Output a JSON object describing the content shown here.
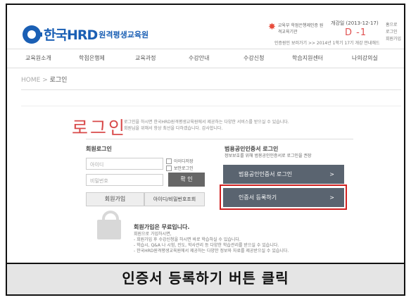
{
  "header": {
    "logo_main": "한국HRD",
    "logo_sub": "원격평생교육원",
    "moe_text": "교육부 학점은행제인증 원격교육기관",
    "dday_top": "개강일 (2013-12-17)",
    "dday": "D -1",
    "login_links": [
      "홈으로",
      "로그인",
      "회원가입"
    ],
    "topinfo": "인증원인 보러가기 >>    2014년 1학기 17기 개강 안내해드"
  },
  "nav": [
    "교육원소개",
    "학점은행제",
    "교육과정",
    "수강안내",
    "수강신청",
    "학습지원센터",
    "나의강의실"
  ],
  "breadcrumb": {
    "home": "HOME",
    "sep": ">",
    "current": "로그인"
  },
  "login": {
    "title": "로그인",
    "desc_1": "로그인을 하시면 한국HRD원격평생교육원에서 제공하는 다양한 서비스를 받으실 수 있습니다.",
    "desc_2": "회원님을 위해서 항상 최선을 다하겠습니다. 감사합니다.",
    "member_title": "회원로그인",
    "id_placeholder": "아이디",
    "pw_placeholder": "비밀번호",
    "save_id": "아이디저장",
    "secure_login": "보안로그인",
    "login_button": "확 인",
    "join_button": "회원가입",
    "find_button": "아이디/비밀번호조회",
    "cert_title": "범용공인인증서 로그인",
    "cert_sub": "정보보호를 위해 범용공인인증서로 로그인을 권장",
    "cert_login_button": "범용공인인증서 로그인",
    "cert_register_button": "인증서 등록하기",
    "arrow": ">"
  },
  "free": {
    "title": "회원가입은 무료입니다.",
    "lines": [
      "회원으로 가입하시면,",
      "- 회원가입 후 수강신청을 하시면 바로 학습하실 수 있습니다.",
      "- 학습시, Q&A 나 시험, 진도, 학사관리 등 다양한 학습관리를 받으실 수 있습니다.",
      "- 한국HRD원격평생교육원에서 제공하는 다양한 정보와 자료를 제공받으실 수 있습니다."
    ]
  },
  "caption": "인증서 등록하기 버튼 클릭",
  "colors": {
    "accent": "#1a5fb4",
    "title_red": "#d84a4a",
    "highlight": "#d02020",
    "button_dark": "#5a6470"
  }
}
